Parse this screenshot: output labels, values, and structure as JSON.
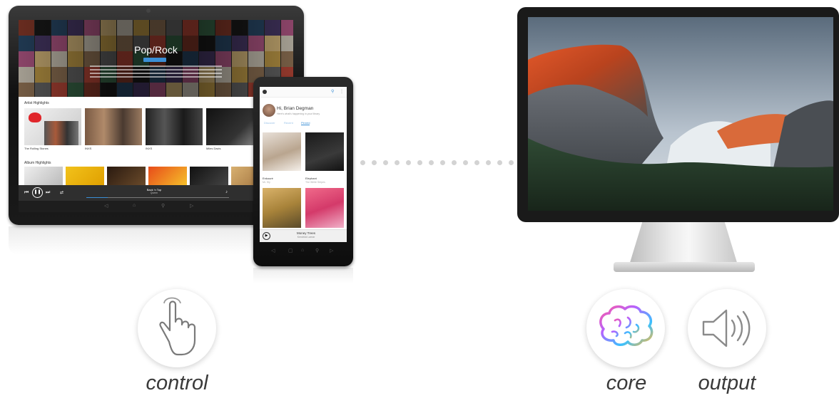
{
  "tablet_app": {
    "hero_title": "Pop/Rock",
    "artist_section_label": "Artist Highlights",
    "artists": [
      "The Rolling Stones",
      "INXS",
      "INXS",
      "Miles Davis"
    ],
    "album_section_label": "Album Highlights",
    "now_playing_title": "Back 'n Top",
    "now_playing_artist": "Queen"
  },
  "phone_app": {
    "greeting": "Hi, Brian Degman",
    "greeting_sub": "Here's what's happening in your library",
    "tabs": [
      "Discover",
      "Recent",
      "Pinned"
    ],
    "items": [
      {
        "title": "Enkouré",
        "artist": "Mr. Sly"
      },
      {
        "title": "Elephant",
        "artist": "The White Stripes"
      }
    ],
    "now_playing_title": "Money Trees",
    "now_playing_artist": "Kendrick Lamar"
  },
  "roles": {
    "control": "control",
    "core": "core",
    "output": "output"
  },
  "icons": {
    "control": "hand-pointer-icon",
    "core": "brain-icon",
    "output": "speaker-icon"
  },
  "colors": {
    "accent": "#3b8fd6",
    "label_text": "#3a3a3a",
    "connector_dots": "#d3d3d3"
  }
}
